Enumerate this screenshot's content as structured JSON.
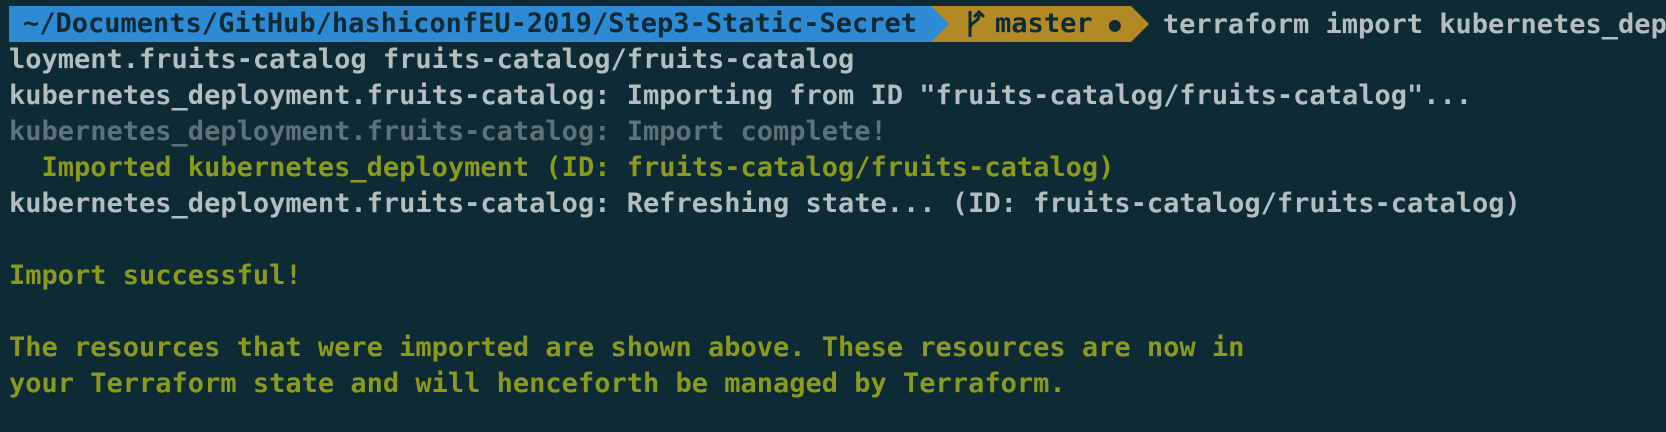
{
  "prompt": {
    "path": "~/Documents/GitHub/hashiconfEU-2019/Step3-Static-Secret",
    "branch": "master",
    "status_dot": "●",
    "command_part1": "terraform import kubernetes_dep",
    "command_part2": "loyment.fruits-catalog fruits-catalog/fruits-catalog"
  },
  "output": {
    "line1": "kubernetes_deployment.fruits-catalog: Importing from ID \"fruits-catalog/fruits-catalog\"...",
    "line2": "kubernetes_deployment.fruits-catalog: Import complete!",
    "line3": "  Imported kubernetes_deployment (ID: fruits-catalog/fruits-catalog)",
    "line4": "kubernetes_deployment.fruits-catalog: Refreshing state... (ID: fruits-catalog/fruits-catalog)",
    "line5": "",
    "line6": "Import successful!",
    "line7": "",
    "line8": "The resources that were imported are shown above. These resources are now in",
    "line9": "your Terraform state and will henceforth be managed by Terraform."
  },
  "colors": {
    "background": "#0d2a35",
    "path_segment": "#2f8ad4",
    "git_segment": "#b38925",
    "text": "#b4bec1",
    "dim_text": "#5e7278",
    "success_text": "#8a9a1c"
  },
  "icons": {
    "branch": "git-branch-icon"
  }
}
